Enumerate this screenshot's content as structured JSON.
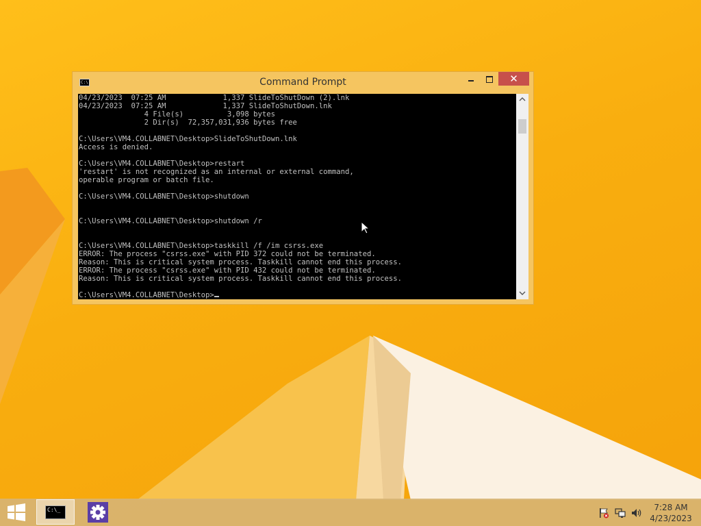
{
  "window": {
    "title": "Command Prompt",
    "icon_text": "C:\\",
    "minimize_icon": "minimize-icon",
    "maximize_icon": "maximize-icon",
    "close_label": "✕"
  },
  "console": {
    "lines": [
      "04/23/2023  07:25 AM             1,337 SlideToShutDown (2).lnk",
      "04/23/2023  07:25 AM             1,337 SlideToShutDown.lnk",
      "               4 File(s)          3,098 bytes",
      "               2 Dir(s)  72,357,031,936 bytes free",
      "",
      "C:\\Users\\VM4.COLLABNET\\Desktop>SlideToShutDown.lnk",
      "Access is denied.",
      "",
      "C:\\Users\\VM4.COLLABNET\\Desktop>restart",
      "'restart' is not recognized as an internal or external command,",
      "operable program or batch file.",
      "",
      "C:\\Users\\VM4.COLLABNET\\Desktop>shutdown",
      "",
      "",
      "C:\\Users\\VM4.COLLABNET\\Desktop>shutdown /r",
      "",
      "",
      "C:\\Users\\VM4.COLLABNET\\Desktop>taskkill /f /im csrss.exe",
      "ERROR: The process \"csrss.exe\" with PID 372 could not be terminated.",
      "Reason: This is critical system process. Taskkill cannot end this process.",
      "ERROR: The process \"csrss.exe\" with PID 432 could not be terminated.",
      "Reason: This is critical system process. Taskkill cannot end this process.",
      ""
    ],
    "prompt": "C:\\Users\\VM4.COLLABNET\\Desktop>"
  },
  "taskbar": {
    "cmd_icon_text": "C:\\_",
    "icons": [
      "start-icon",
      "command-prompt-icon",
      "settings-gear-icon",
      "action-center-flag-icon",
      "network-icon",
      "volume-icon"
    ],
    "time": "7:28 AM",
    "date": "4/23/2023"
  },
  "colors": {
    "wallpaper": "#f9ae0f",
    "console_bg": "#000000",
    "console_text": "#c0c0c0",
    "close_button": "#c7504b",
    "settings_tile": "#5a3ea6"
  }
}
